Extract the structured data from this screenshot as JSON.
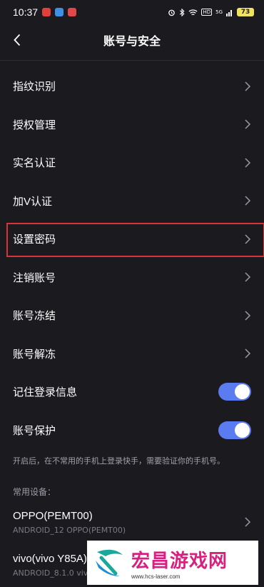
{
  "status_bar": {
    "time": "10:37",
    "network": "HD",
    "signal": "5G",
    "battery": "73"
  },
  "header": {
    "title": "账号与安全"
  },
  "settings": [
    {
      "label": "指纹识别"
    },
    {
      "label": "授权管理"
    },
    {
      "label": "实名认证"
    },
    {
      "label": "加V认证"
    },
    {
      "label": "设置密码"
    },
    {
      "label": "注销账号"
    },
    {
      "label": "账号冻结"
    },
    {
      "label": "账号解冻"
    }
  ],
  "toggles": [
    {
      "label": "记住登录信息",
      "on": true
    },
    {
      "label": "账号保护",
      "on": true
    }
  ],
  "note": "开启后，在不常用的手机上登录快手，需要验证你的手机号。",
  "devices_section": "常用设备：",
  "devices": [
    {
      "name": "OPPO(PEMT00)",
      "sub": "ANDROID_12 OPPO(PEMT00)"
    },
    {
      "name": "vivo(vivo Y85A)",
      "sub": "ANDROID_8.1.0 vivo(vivo Y85A)"
    }
  ],
  "watermark": {
    "title": "宏昌游戏网",
    "url": "www.hcs-laser.com"
  },
  "colors": {
    "background": "#1a1a1f",
    "toggle_on": "#5b7bf1",
    "highlight": "#d9333a",
    "watermark_text": "#d8207f"
  }
}
